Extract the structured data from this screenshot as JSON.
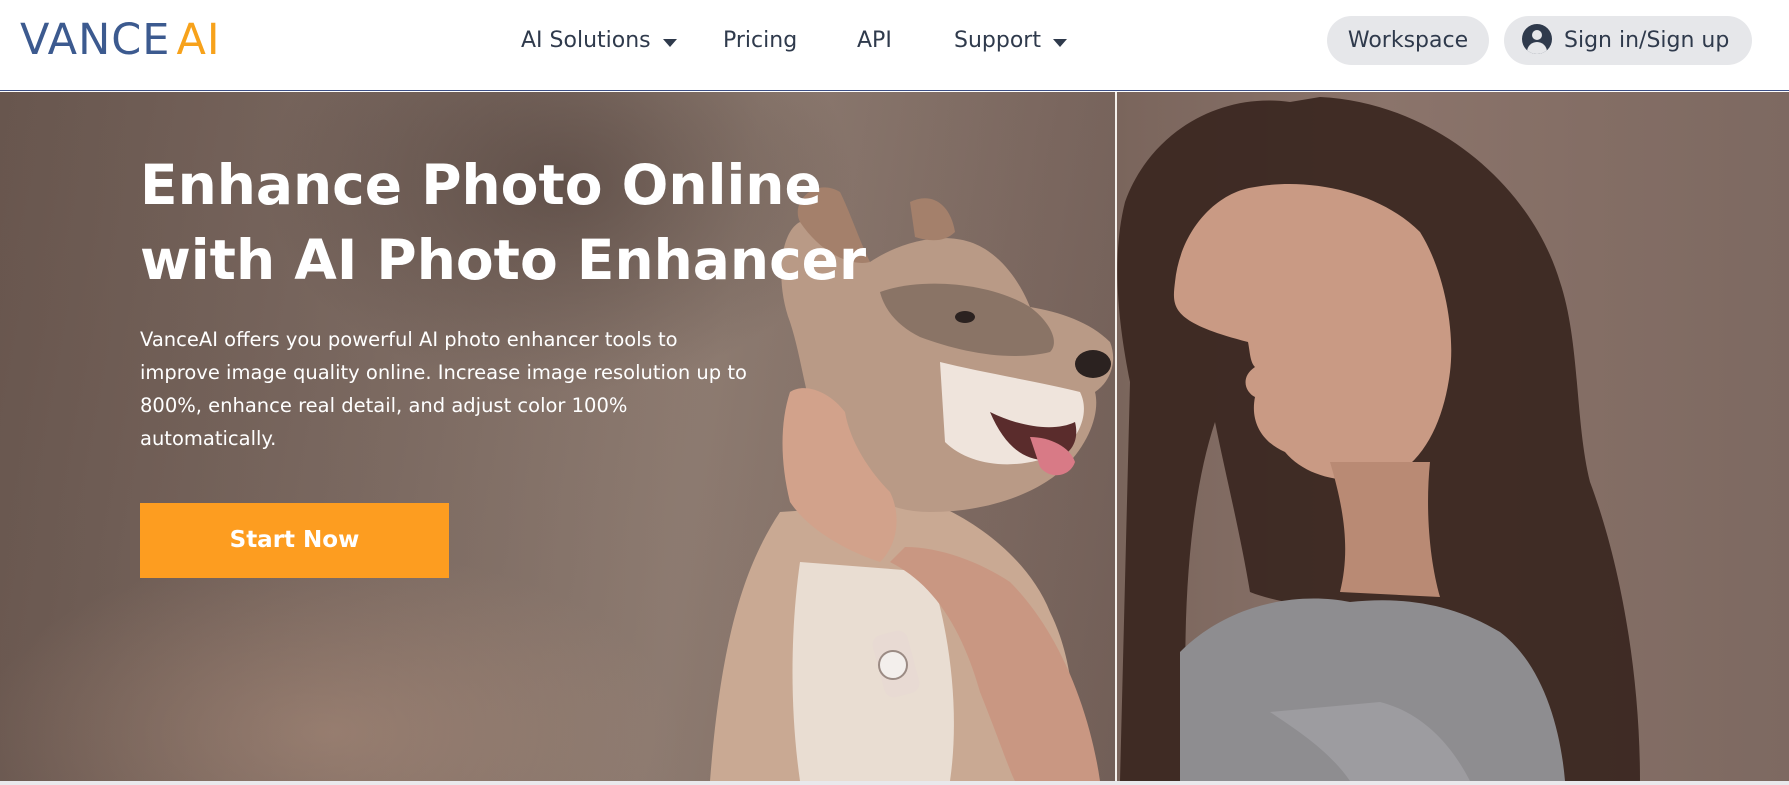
{
  "brand": {
    "logo_part1": "VANCE",
    "logo_part2": "AI",
    "primary_color": "#3c5a8f",
    "accent_color": "#f7a21b"
  },
  "nav": {
    "items": [
      {
        "label": "AI Solutions",
        "has_dropdown": true
      },
      {
        "label": "Pricing",
        "has_dropdown": false
      },
      {
        "label": "API",
        "has_dropdown": false
      },
      {
        "label": "Support",
        "has_dropdown": true
      }
    ],
    "workspace_label": "Workspace",
    "signin_label": "Sign in/Sign up",
    "signin_icon": "user-avatar-icon",
    "dropdown_icon": "caret-down-icon"
  },
  "hero": {
    "title": "Enhance Photo Online with AI Photo Enhancer",
    "description": "VanceAI offers you powerful AI photo enhancer tools to improve image quality online. Increase image resolution up to 800%, enhance real detail, and adjust color 100% automatically.",
    "cta_label": "Start Now",
    "cta_color": "#fd9d20",
    "image": "before-after comparison of a woman holding a dog"
  }
}
